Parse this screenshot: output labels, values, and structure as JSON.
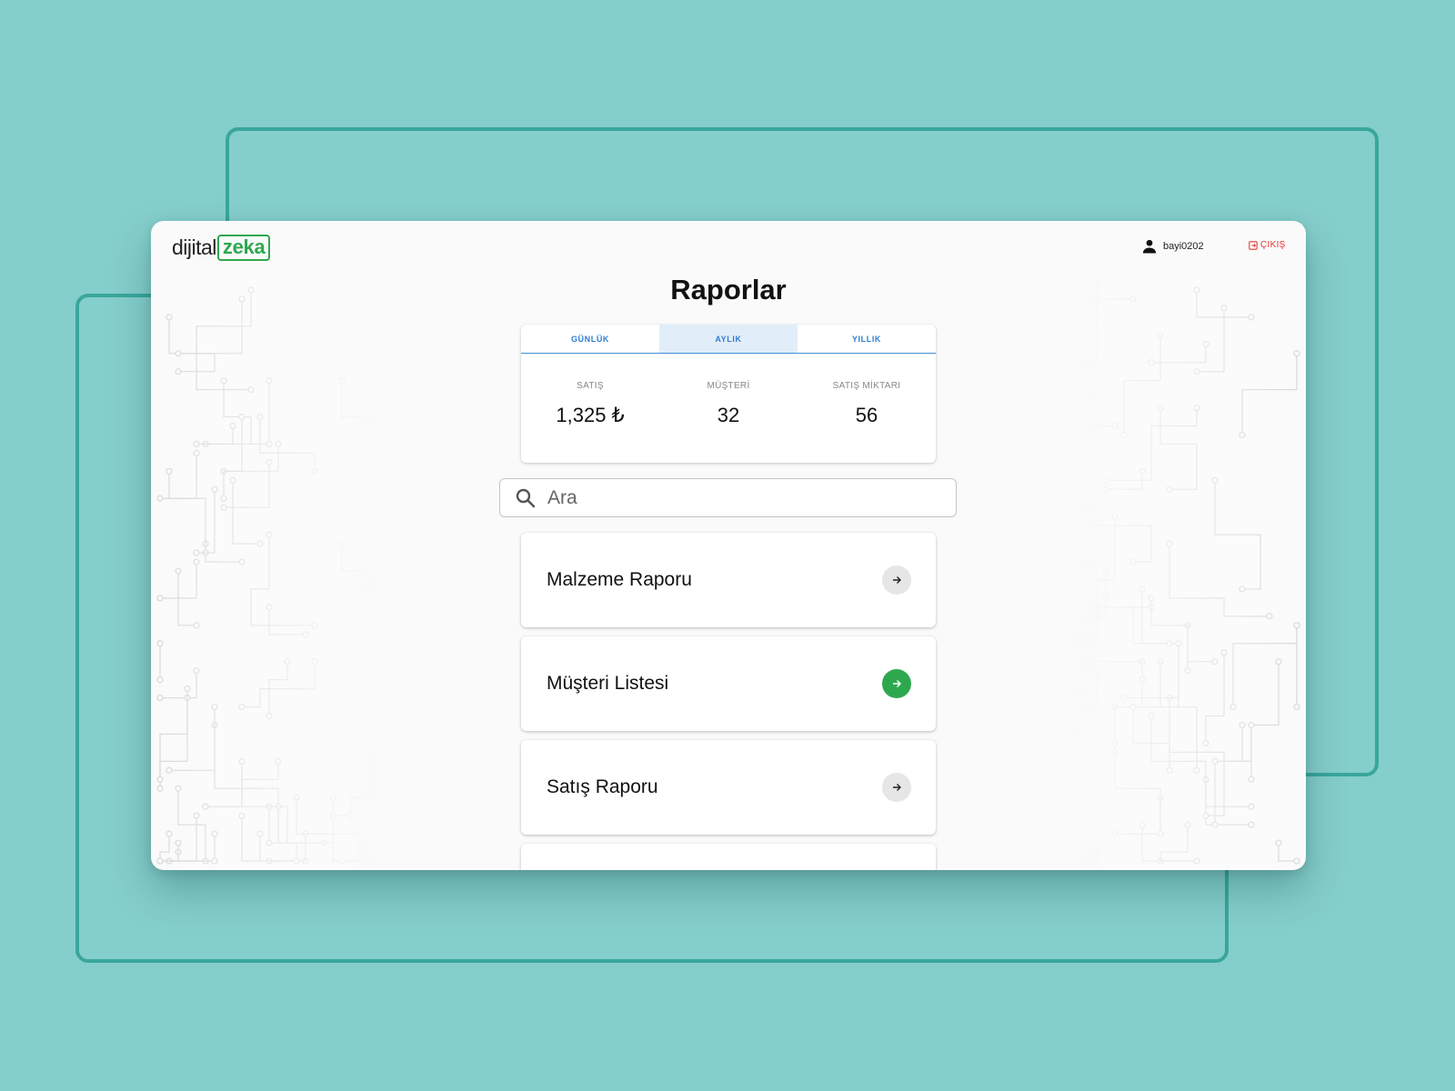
{
  "app": {
    "logo_prefix": "dijital",
    "logo_accent": "zeka"
  },
  "header": {
    "username": "bayi0202",
    "logout_label": "ÇIKIŞ"
  },
  "page": {
    "title": "Raporlar"
  },
  "tabs": [
    {
      "label": "GÜNLÜK",
      "active": false
    },
    {
      "label": "AYLIK",
      "active": true
    },
    {
      "label": "YILLIK",
      "active": false
    }
  ],
  "stats": [
    {
      "label": "SATIŞ",
      "value": "1,325 ₺"
    },
    {
      "label": "MÜŞTERİ",
      "value": "32"
    },
    {
      "label": "SATIŞ MİKTARI",
      "value": "56"
    }
  ],
  "search": {
    "placeholder": "Ara",
    "value": ""
  },
  "reports": [
    {
      "label": "Malzeme Raporu",
      "highlighted": false
    },
    {
      "label": "Müşteri Listesi",
      "highlighted": true
    },
    {
      "label": "Satış Raporu",
      "highlighted": false
    },
    {
      "label": "",
      "highlighted": false
    }
  ],
  "colors": {
    "background": "#84cecb",
    "frame": "#3aa69c",
    "brand_green": "#2ea84f",
    "tab_blue": "#2f7ed0",
    "tab_active_bg": "#e1eef9",
    "logout_red": "#e53935"
  },
  "icons": {
    "user": "user-icon",
    "logout": "logout-icon",
    "search": "search-icon",
    "arrow": "arrow-right-icon"
  }
}
